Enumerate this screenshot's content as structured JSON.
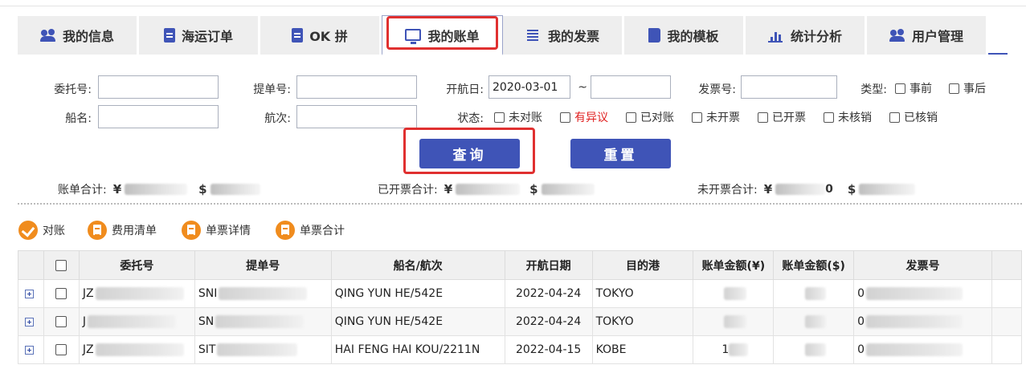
{
  "tabs": [
    {
      "label": "我的信息",
      "icon": "users-icon"
    },
    {
      "label": "海运订单",
      "icon": "document-icon"
    },
    {
      "label": "OK 拼",
      "icon": "document-icon"
    },
    {
      "label": "我的账单",
      "icon": "monitor-icon",
      "active": true
    },
    {
      "label": "我的发票",
      "icon": "list-icon"
    },
    {
      "label": "我的模板",
      "icon": "book-icon"
    },
    {
      "label": "统计分析",
      "icon": "bar-chart-icon"
    },
    {
      "label": "用户管理",
      "icon": "users-icon"
    }
  ],
  "search": {
    "consignor_label": "委托号:",
    "bl_label": "提单号:",
    "sail_date_label": "开航日:",
    "sail_date_from": "2020-03-01",
    "date_sep": "~",
    "invoice_label": "发票号:",
    "type_label": "类型:",
    "type_options": [
      "事前",
      "事后"
    ],
    "vessel_label": "船名:",
    "voyage_label": "航次:",
    "status_label": "状态:",
    "status_options": [
      "未对账",
      "有异议",
      "已对账",
      "未开票",
      "已开票",
      "未核销",
      "已核销"
    ],
    "query_button": "查询",
    "reset_button": "重置"
  },
  "summary": {
    "bill_total_label": "账单合计:",
    "invoiced_total_label": "已开票合计:",
    "uninvoiced_total_label": "未开票合计:",
    "cny": "¥",
    "usd": "$",
    "uninvoiced_cny_suffix": "0"
  },
  "actions": [
    "对账",
    "费用清单",
    "单票详情",
    "单票合计"
  ],
  "table": {
    "headers": [
      "委托号",
      "提单号",
      "船名/航次",
      "开航日期",
      "目的港",
      "账单金额(¥)",
      "账单金额($)",
      "发票号"
    ],
    "rows": [
      {
        "consignor": "JZ",
        "bl": "SNI",
        "vessel": "QING YUN HE/542E",
        "date": "2022-04-24",
        "port": "TOKYO",
        "cny": "",
        "invoice": "0"
      },
      {
        "consignor": "J",
        "bl": "SN",
        "vessel": "QING YUN HE/542E",
        "date": "2022-04-24",
        "port": "TOKYO",
        "cny": "",
        "invoice": "0"
      },
      {
        "consignor": "JZ",
        "bl": "SIT",
        "vessel": "HAI FENG HAI KOU/2211N",
        "date": "2022-04-15",
        "port": "KOBE",
        "cny": "1",
        "invoice": "0"
      }
    ]
  },
  "colors": {
    "accent": "#3f54b7",
    "highlight": "#e03030",
    "action_icon": "#f08c1e"
  }
}
